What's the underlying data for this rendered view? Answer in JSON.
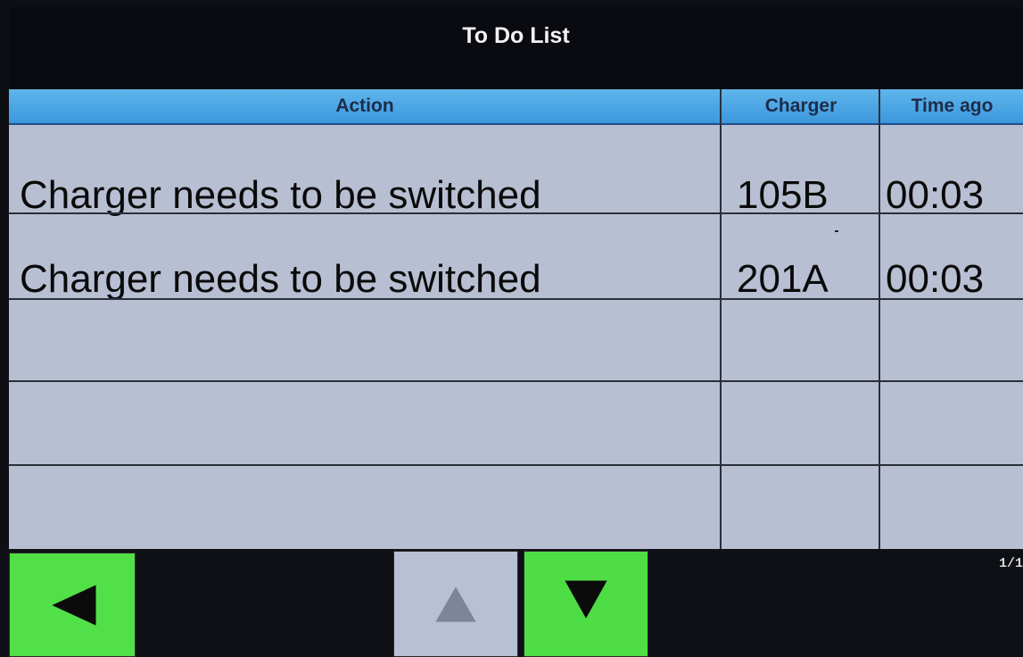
{
  "screen": {
    "title": "To Do List"
  },
  "table": {
    "columns": [
      "Action",
      "Charger",
      "Time ago"
    ],
    "rows": [
      [
        "Charger needs to be switched",
        "105B",
        "00:03"
      ],
      [
        "Charger needs to be switched",
        "201A",
        "00:03"
      ],
      [
        "",
        "",
        ""
      ],
      [
        "",
        "",
        ""
      ],
      [
        "",
        "",
        ""
      ]
    ]
  },
  "footer": {
    "buttons": {
      "previous_icon": "triangle-left-icon",
      "scroll_up_icon": "triangle-up-icon",
      "scroll_down_icon": "triangle-down-icon"
    },
    "page_indicator": "1/1"
  },
  "colors": {
    "header_blue": "#4aa6e4",
    "table_bg": "#b9bfd2",
    "button_green": "#52e049",
    "button_disabled": "#b8c0d6",
    "screen_bg": "#0d0f14"
  }
}
